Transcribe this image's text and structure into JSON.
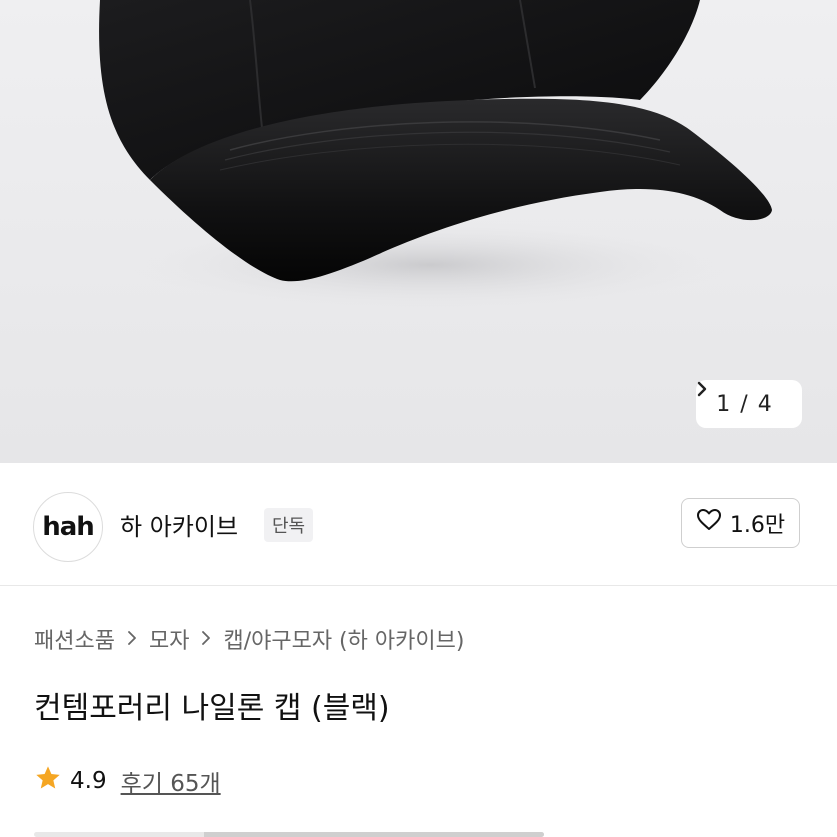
{
  "gallery": {
    "current": "1",
    "separator": "/",
    "total": "4",
    "next_icon": "chevron-right-icon"
  },
  "seller": {
    "logo_text": "hah",
    "name": "하 아카이브",
    "badge": "단독",
    "like_count": "1.6만",
    "like_icon": "heart-outline-icon"
  },
  "breadcrumb": {
    "items": [
      "패션소품",
      "모자",
      "캡/야구모자 (하 아카이브)"
    ],
    "separator_icon": "chevron-right-icon"
  },
  "product": {
    "title": "컨템포러리 나일론 캡 (블랙)"
  },
  "rating": {
    "star_icon": "star-icon",
    "star_color": "#f5a623",
    "score": "4.9",
    "reviews_label": "후기 65개"
  },
  "colors": {
    "hero_bg": "#eaeaec",
    "cap": "#0f0f10"
  }
}
